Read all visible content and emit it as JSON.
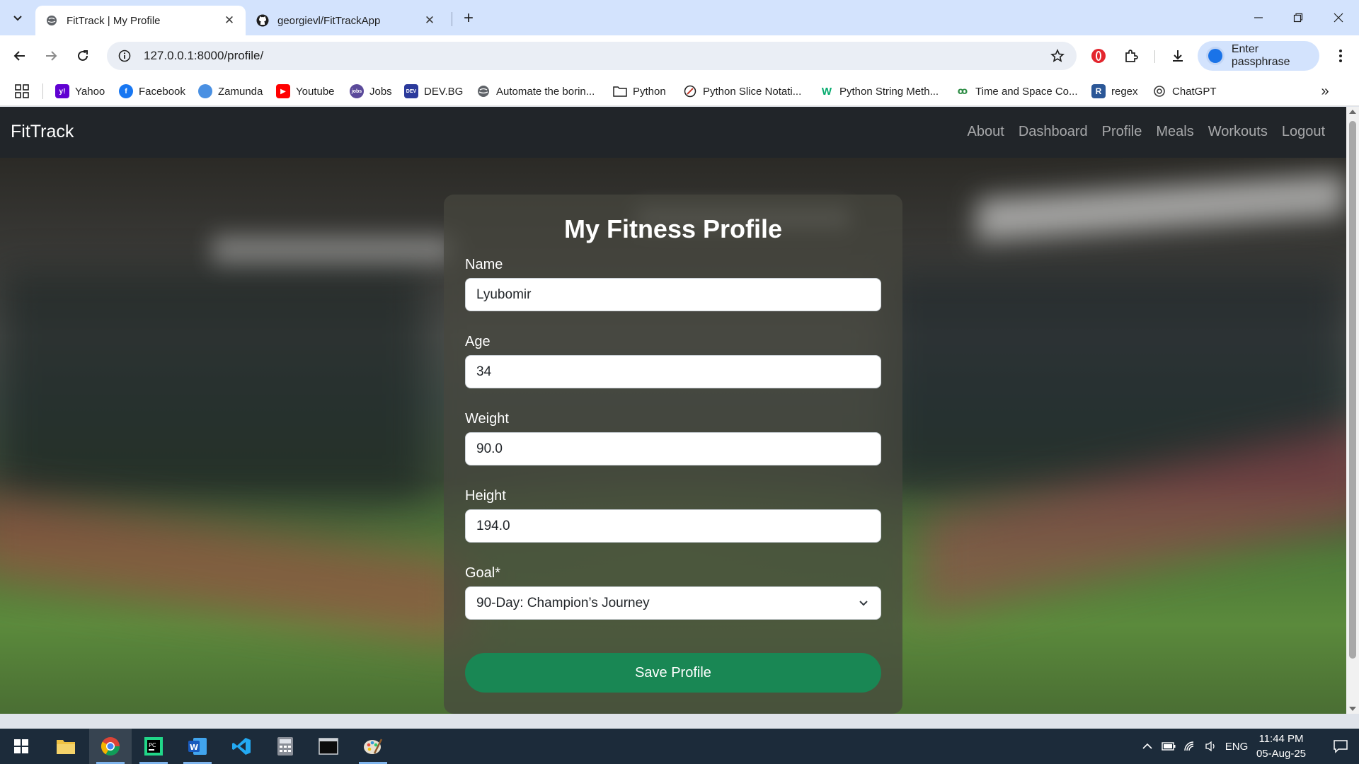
{
  "browser": {
    "tabs": [
      {
        "title": "FitTrack | My Profile",
        "active": true
      },
      {
        "title": "georgievl/FitTrackApp",
        "active": false
      }
    ],
    "url": "127.0.0.1:8000/profile/",
    "profile_chip": "Enter passphrase",
    "bookmarks": [
      {
        "label": "Yahoo",
        "icon": "yahoo-icon",
        "color": "#6001d2"
      },
      {
        "label": "Facebook",
        "icon": "facebook-icon",
        "color": "#1877f2"
      },
      {
        "label": "Zamunda",
        "icon": "zamunda-icon",
        "color": "#3b82f6"
      },
      {
        "label": "Youtube",
        "icon": "youtube-icon",
        "color": "#ff0000"
      },
      {
        "label": "Jobs",
        "icon": "jobs-icon",
        "color": "#5b4a9a"
      },
      {
        "label": "DEV.BG",
        "icon": "devbg-icon",
        "color": "#2b3a9b"
      },
      {
        "label": "Automate the borin...",
        "icon": "globe-icon",
        "color": "#5f6368"
      },
      {
        "label": "Python",
        "icon": "folder-icon",
        "color": "#5f6368"
      },
      {
        "label": "Python Slice Notati...",
        "icon": "slice-icon",
        "color": "#c0392b"
      },
      {
        "label": "Python String Meth...",
        "icon": "w3-icon",
        "color": "#04aa6d"
      },
      {
        "label": "Time and Space Co...",
        "icon": "gfg-icon",
        "color": "#2f8d46"
      },
      {
        "label": "regex",
        "icon": "regex-icon",
        "color": "#2b5797"
      },
      {
        "label": "ChatGPT",
        "icon": "chatgpt-icon",
        "color": "#3c3c3c"
      }
    ]
  },
  "site": {
    "brand": "FitTrack",
    "nav": [
      "About",
      "Dashboard",
      "Profile",
      "Meals",
      "Workouts",
      "Logout"
    ]
  },
  "form": {
    "title": "My Fitness Profile",
    "fields": [
      {
        "label": "Name",
        "value": "Lyubomir"
      },
      {
        "label": "Age",
        "value": "34"
      },
      {
        "label": "Weight",
        "value": "90.0"
      },
      {
        "label": "Height",
        "value": "194.0"
      }
    ],
    "goal": {
      "label": "Goal*",
      "value": "90-Day: Champion’s Journey"
    },
    "submit": "Save Profile"
  },
  "taskbar": {
    "language": "ENG",
    "time": "11:44 PM",
    "date": "05-Aug-25"
  },
  "colors": {
    "navbar": "#212529",
    "button": "#198754",
    "browser_accent": "#d3e3fd"
  }
}
